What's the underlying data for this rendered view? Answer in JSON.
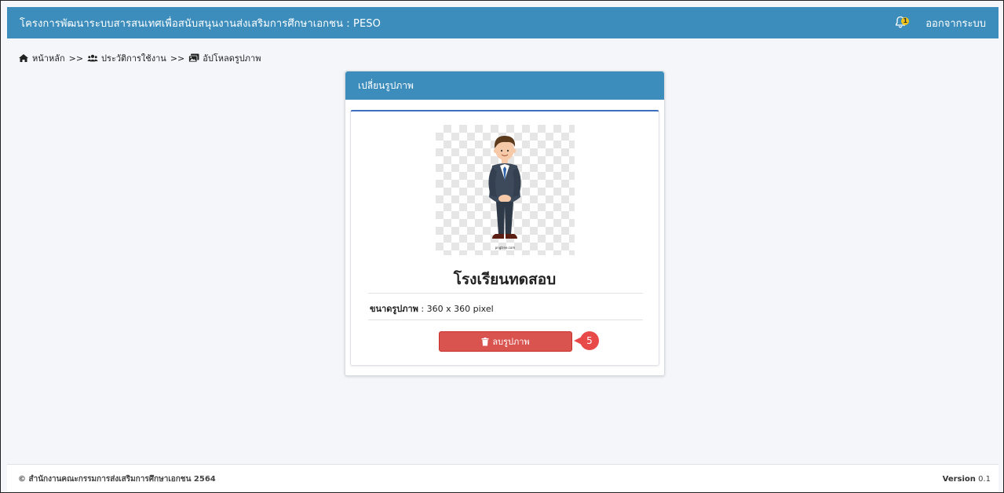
{
  "header": {
    "title": "โครงการพัฒนาระบบสารสนเทศเพื่อสนับสนุนงานส่งเสริมการศึกษาเอกชน : PESO",
    "notification_count": "1",
    "logout_label": "ออกจากระบบ",
    "bg_color": "#3c8dbc"
  },
  "breadcrumb": {
    "home": "หน้าหลัก",
    "separator": ">>",
    "history": "ประวัติการใช้งาน",
    "current": "อัปโหลดรูปภาพ"
  },
  "card": {
    "title": "เปลี่ยนรูปภาพ",
    "photo_watermark": "pngtree.com",
    "school_name": "โรงเรียนทดสอบ",
    "size_label": "ขนาดรูปภาพ",
    "size_value": " : 360 x 360 pixel",
    "delete_label": "ลบรูปภาพ",
    "delete_color": "#d9534f"
  },
  "step_marker": "5",
  "footer": {
    "copyright": "© สำนักงานคณะกรรมการส่งเสริมการศึกษาเอกชน 2564",
    "version_label": "Version",
    "version_value": "0.1"
  }
}
